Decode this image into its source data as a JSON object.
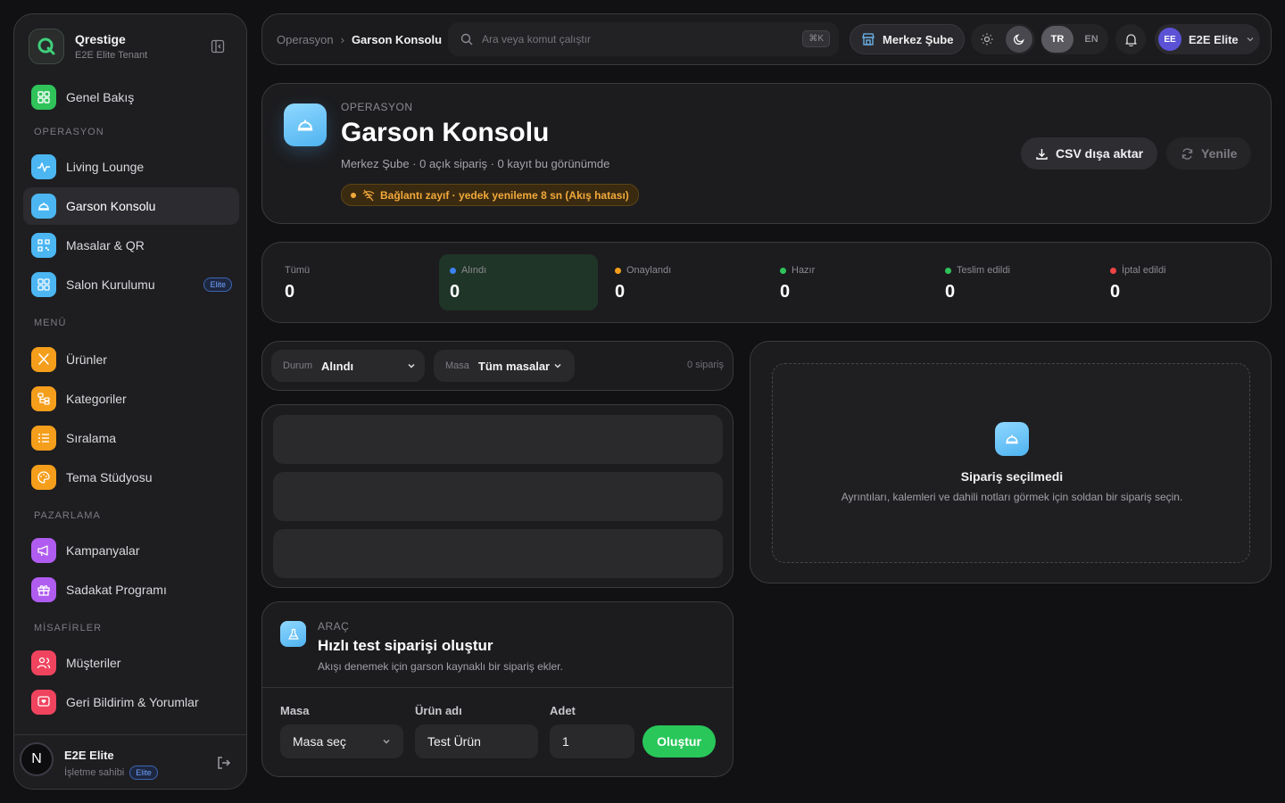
{
  "brand": {
    "name": "Qrestige",
    "tenant": "E2E Elite Tenant"
  },
  "sidebar": {
    "overview": {
      "label": "Genel Bakış",
      "color": "#2fc35a"
    },
    "sections": [
      {
        "title": "OPERASYON",
        "items": [
          {
            "label": "Living Lounge",
            "color": "#4bb6f2"
          },
          {
            "label": "Garson Konsolu",
            "color": "#4bb6f2",
            "active": true
          },
          {
            "label": "Masalar & QR",
            "color": "#4bb6f2"
          },
          {
            "label": "Salon Kurulumu",
            "color": "#4bb6f2",
            "badge": "Elite"
          }
        ]
      },
      {
        "title": "MENÜ",
        "items": [
          {
            "label": "Ürünler",
            "color": "#f59e1b"
          },
          {
            "label": "Kategoriler",
            "color": "#f59e1b"
          },
          {
            "label": "Sıralama",
            "color": "#f59e1b"
          },
          {
            "label": "Tema Stüdyosu",
            "color": "#f59e1b"
          }
        ]
      },
      {
        "title": "PAZARLAMA",
        "items": [
          {
            "label": "Kampanyalar",
            "color": "#b05cf0"
          },
          {
            "label": "Sadakat Programı",
            "color": "#b05cf0"
          }
        ]
      },
      {
        "title": "MİSAFİRLER",
        "items": [
          {
            "label": "Müşteriler",
            "color": "#f0445e"
          },
          {
            "label": "Geri Bildirim & Yorumlar",
            "color": "#f0445e"
          }
        ]
      }
    ],
    "user": {
      "initial": "N",
      "name": "E2E Elite",
      "role": "İşletme sahibi",
      "badge": "Elite"
    }
  },
  "topbar": {
    "breadcrumb": [
      "Operasyon",
      "Garson Konsolu"
    ],
    "search_placeholder": "Ara veya komut çalıştır",
    "shortcut": "⌘K",
    "branch": "Merkez Şube",
    "languages": [
      "TR",
      "EN"
    ],
    "active_language": "TR",
    "account": {
      "initials": "EE",
      "name": "E2E Elite"
    }
  },
  "header": {
    "kicker": "OPERASYON",
    "title": "Garson Konsolu",
    "meta": "Merkez Şube · 0 açık sipariş · 0 kayıt bu görünümde",
    "warning": "Bağlantı zayıf · yedek yenileme 8 sn (Akış hatası)",
    "csv_label": "CSV dışa aktar",
    "refresh_label": "Yenile"
  },
  "stats": [
    {
      "label": "Tümü",
      "value": "0",
      "dot": ""
    },
    {
      "label": "Alındı",
      "value": "0",
      "dot": "#3b82f6",
      "active": true
    },
    {
      "label": "Onaylandı",
      "value": "0",
      "dot": "#f59e1b"
    },
    {
      "label": "Hazır",
      "value": "0",
      "dot": "#2fc35a"
    },
    {
      "label": "Teslim edildi",
      "value": "0",
      "dot": "#2fc35a"
    },
    {
      "label": "İptal edildi",
      "value": "0",
      "dot": "#ef4444"
    }
  ],
  "filters": {
    "status_key": "Durum",
    "status_value": "Alındı",
    "table_key": "Masa",
    "table_value": "Tüm masalar",
    "count": "0 sipariş"
  },
  "detail": {
    "empty_title": "Sipariş seçilmedi",
    "empty_desc": "Ayrıntıları, kalemleri ve dahili notları görmek için soldan bir sipariş seçin."
  },
  "tool": {
    "kicker": "ARAÇ",
    "title": "Hızlı test siparişi oluştur",
    "desc": "Akışı denemek için garson kaynaklı bir sipariş ekler.",
    "table_label": "Masa",
    "table_value": "Masa seç",
    "product_label": "Ürün adı",
    "product_value": "Test Ürün",
    "qty_label": "Adet",
    "qty_value": "1",
    "create_label": "Oluştur"
  }
}
